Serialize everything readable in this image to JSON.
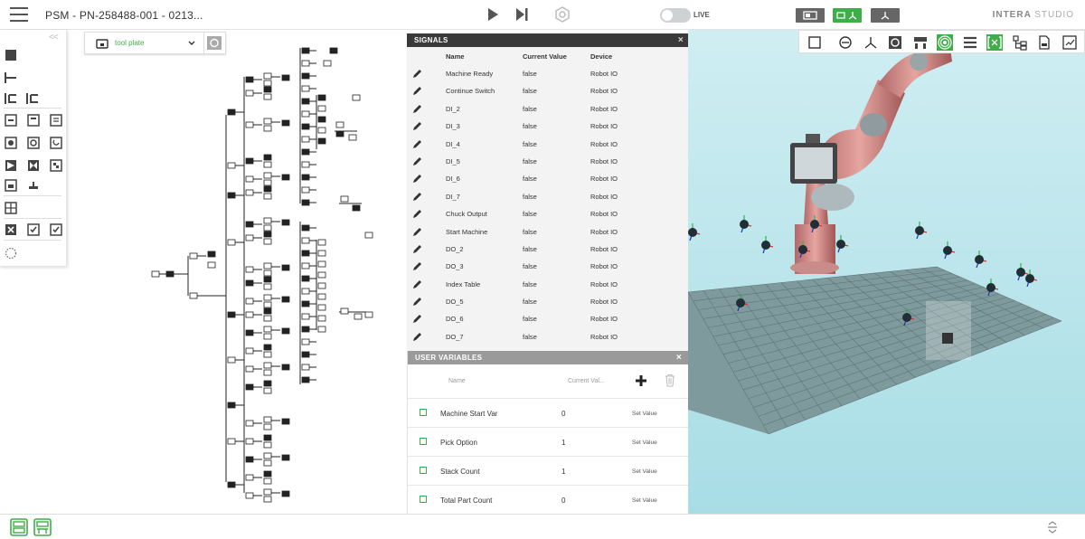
{
  "header": {
    "title": "PSM - PN-258488-001 - 0213...",
    "live_label": "LIVE",
    "brand_main": "INTERA",
    "brand_sub": "STUDIO"
  },
  "context_selector": {
    "label": "tool plate"
  },
  "signals_panel": {
    "title": "SIGNALS",
    "close": "×",
    "columns": [
      "Name",
      "Current Value",
      "Device"
    ],
    "rows": [
      {
        "name": "Machine Ready",
        "value": "false",
        "device": "Robot IO"
      },
      {
        "name": "Continue Switch",
        "value": "false",
        "device": "Robot IO"
      },
      {
        "name": "DI_2",
        "value": "false",
        "device": "Robot IO"
      },
      {
        "name": "DI_3",
        "value": "false",
        "device": "Robot IO"
      },
      {
        "name": "DI_4",
        "value": "false",
        "device": "Robot IO"
      },
      {
        "name": "DI_5",
        "value": "false",
        "device": "Robot IO"
      },
      {
        "name": "DI_6",
        "value": "false",
        "device": "Robot IO"
      },
      {
        "name": "DI_7",
        "value": "false",
        "device": "Robot IO"
      },
      {
        "name": "Chuck Output",
        "value": "false",
        "device": "Robot IO"
      },
      {
        "name": "Start Machine",
        "value": "false",
        "device": "Robot IO"
      },
      {
        "name": "DO_2",
        "value": "false",
        "device": "Robot IO"
      },
      {
        "name": "DO_3",
        "value": "false",
        "device": "Robot IO"
      },
      {
        "name": "Index Table",
        "value": "false",
        "device": "Robot IO"
      },
      {
        "name": "DO_5",
        "value": "false",
        "device": "Robot IO"
      },
      {
        "name": "DO_6",
        "value": "false",
        "device": "Robot IO"
      },
      {
        "name": "DO_7",
        "value": "false",
        "device": "Robot IO"
      }
    ]
  },
  "user_variables": {
    "title": "USER VARIABLES",
    "close": "×",
    "col_name": "Name",
    "col_value": "Current Val...",
    "rows": [
      {
        "name": "Machine Start Var",
        "value": "0",
        "action": "Set Value"
      },
      {
        "name": "Pick Option",
        "value": "1",
        "action": "Set Value"
      },
      {
        "name": "Stack Count",
        "value": "1",
        "action": "Set Value"
      },
      {
        "name": "Total Part Count",
        "value": "0",
        "action": "Set Value"
      }
    ]
  },
  "colors": {
    "accent": "#3fae49",
    "panel_header": "#3a3a3a",
    "scene_bg": "#b6e3ea",
    "floor": "#7f9a9d"
  }
}
